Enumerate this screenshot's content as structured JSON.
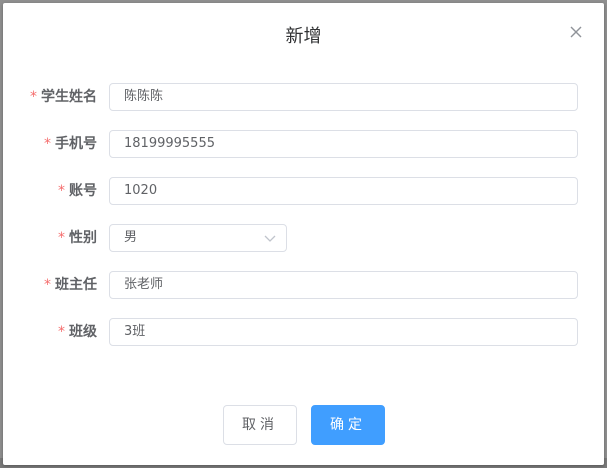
{
  "dialog": {
    "title": "新增"
  },
  "form": {
    "required_mark": "*",
    "fields": [
      {
        "label": "学生姓名",
        "value": "陈陈陈"
      },
      {
        "label": "手机号",
        "value": "18199995555"
      },
      {
        "label": "账号",
        "value": "1020"
      },
      {
        "label": "性别",
        "value": "男"
      },
      {
        "label": "班主任",
        "value": "张老师"
      },
      {
        "label": "班级",
        "value": "3班"
      }
    ]
  },
  "footer": {
    "cancel_label": "取消",
    "confirm_label": "确定"
  },
  "colors": {
    "primary": "#409eff",
    "required": "#f56c6c",
    "border": "#dcdfe6",
    "text": "#606266"
  },
  "icons": {
    "close": "close-icon",
    "select_arrow": "chevron-down-icon"
  }
}
